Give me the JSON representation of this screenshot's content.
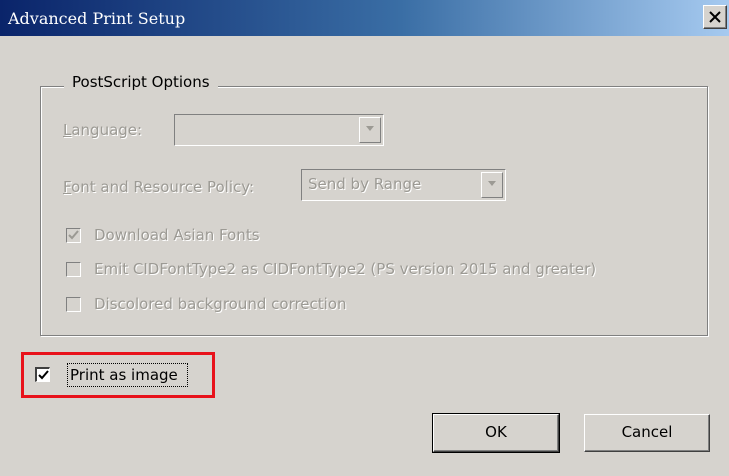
{
  "window": {
    "title": "Advanced Print Setup"
  },
  "group": {
    "title": "PostScript Options"
  },
  "language": {
    "label": "Language:",
    "value": ""
  },
  "font_policy": {
    "label": "Font and Resource Policy:",
    "value": "Send by Range"
  },
  "options": [
    {
      "label": "Download Asian Fonts",
      "checked": true,
      "enabled": false
    },
    {
      "label": "Emit CIDFontType2 as CIDFontType2 (PS version 2015 and greater)",
      "checked": false,
      "enabled": false
    },
    {
      "label": "Discolored background correction",
      "checked": false,
      "enabled": false
    }
  ],
  "print_as_image": {
    "label": "Print as image",
    "checked": true
  },
  "buttons": {
    "ok": "OK",
    "cancel": "Cancel"
  },
  "colors": {
    "highlight": "#e8121b",
    "title_bar": "#0a246a",
    "dialog_bg": "#d6d3ce"
  }
}
